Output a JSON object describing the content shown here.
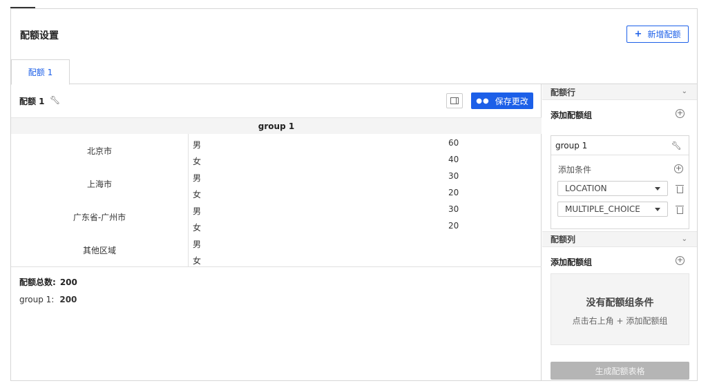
{
  "header": {
    "title": "配额设置",
    "add_quota_label": "新增配额",
    "add_icon": "+"
  },
  "tabs": [
    {
      "label": "配额 1",
      "active": true
    }
  ],
  "quota": {
    "name": "配额 1",
    "save_label": "保存更改",
    "table": {
      "group_header": "group 1",
      "rows": [
        {
          "city": "北京市",
          "items": [
            {
              "gender": "男",
              "value": "60"
            },
            {
              "gender": "女",
              "value": "40"
            }
          ]
        },
        {
          "city": "上海市",
          "items": [
            {
              "gender": "男",
              "value": "30"
            },
            {
              "gender": "女",
              "value": "20"
            }
          ]
        },
        {
          "city": "广东省-广州市",
          "items": [
            {
              "gender": "男",
              "value": "30"
            },
            {
              "gender": "女",
              "value": "20"
            }
          ]
        },
        {
          "city": "其他区域",
          "items": [
            {
              "gender": "男",
              "value": ""
            },
            {
              "gender": "女",
              "value": ""
            }
          ]
        }
      ]
    },
    "summary": {
      "total_label": "配额总数:",
      "total_value": "200",
      "group_label": "group 1:",
      "group_value": "200"
    }
  },
  "sidebar": {
    "rows_section": {
      "title": "配额行",
      "add_group_label": "添加配额组",
      "group": {
        "name": "group 1",
        "add_condition_label": "添加条件",
        "conditions": [
          "LOCATION",
          "MULTIPLE_CHOICE"
        ]
      }
    },
    "cols_section": {
      "title": "配额列",
      "add_group_label": "添加配额组",
      "empty_title": "没有配额组条件",
      "empty_hint": "点击右上角 + 添加配额组"
    },
    "generate_label": "生成配额表格"
  },
  "colors": {
    "accent": "#1c5fe8",
    "disabled": "#b5b5b5",
    "border": "#d6d6d6"
  }
}
